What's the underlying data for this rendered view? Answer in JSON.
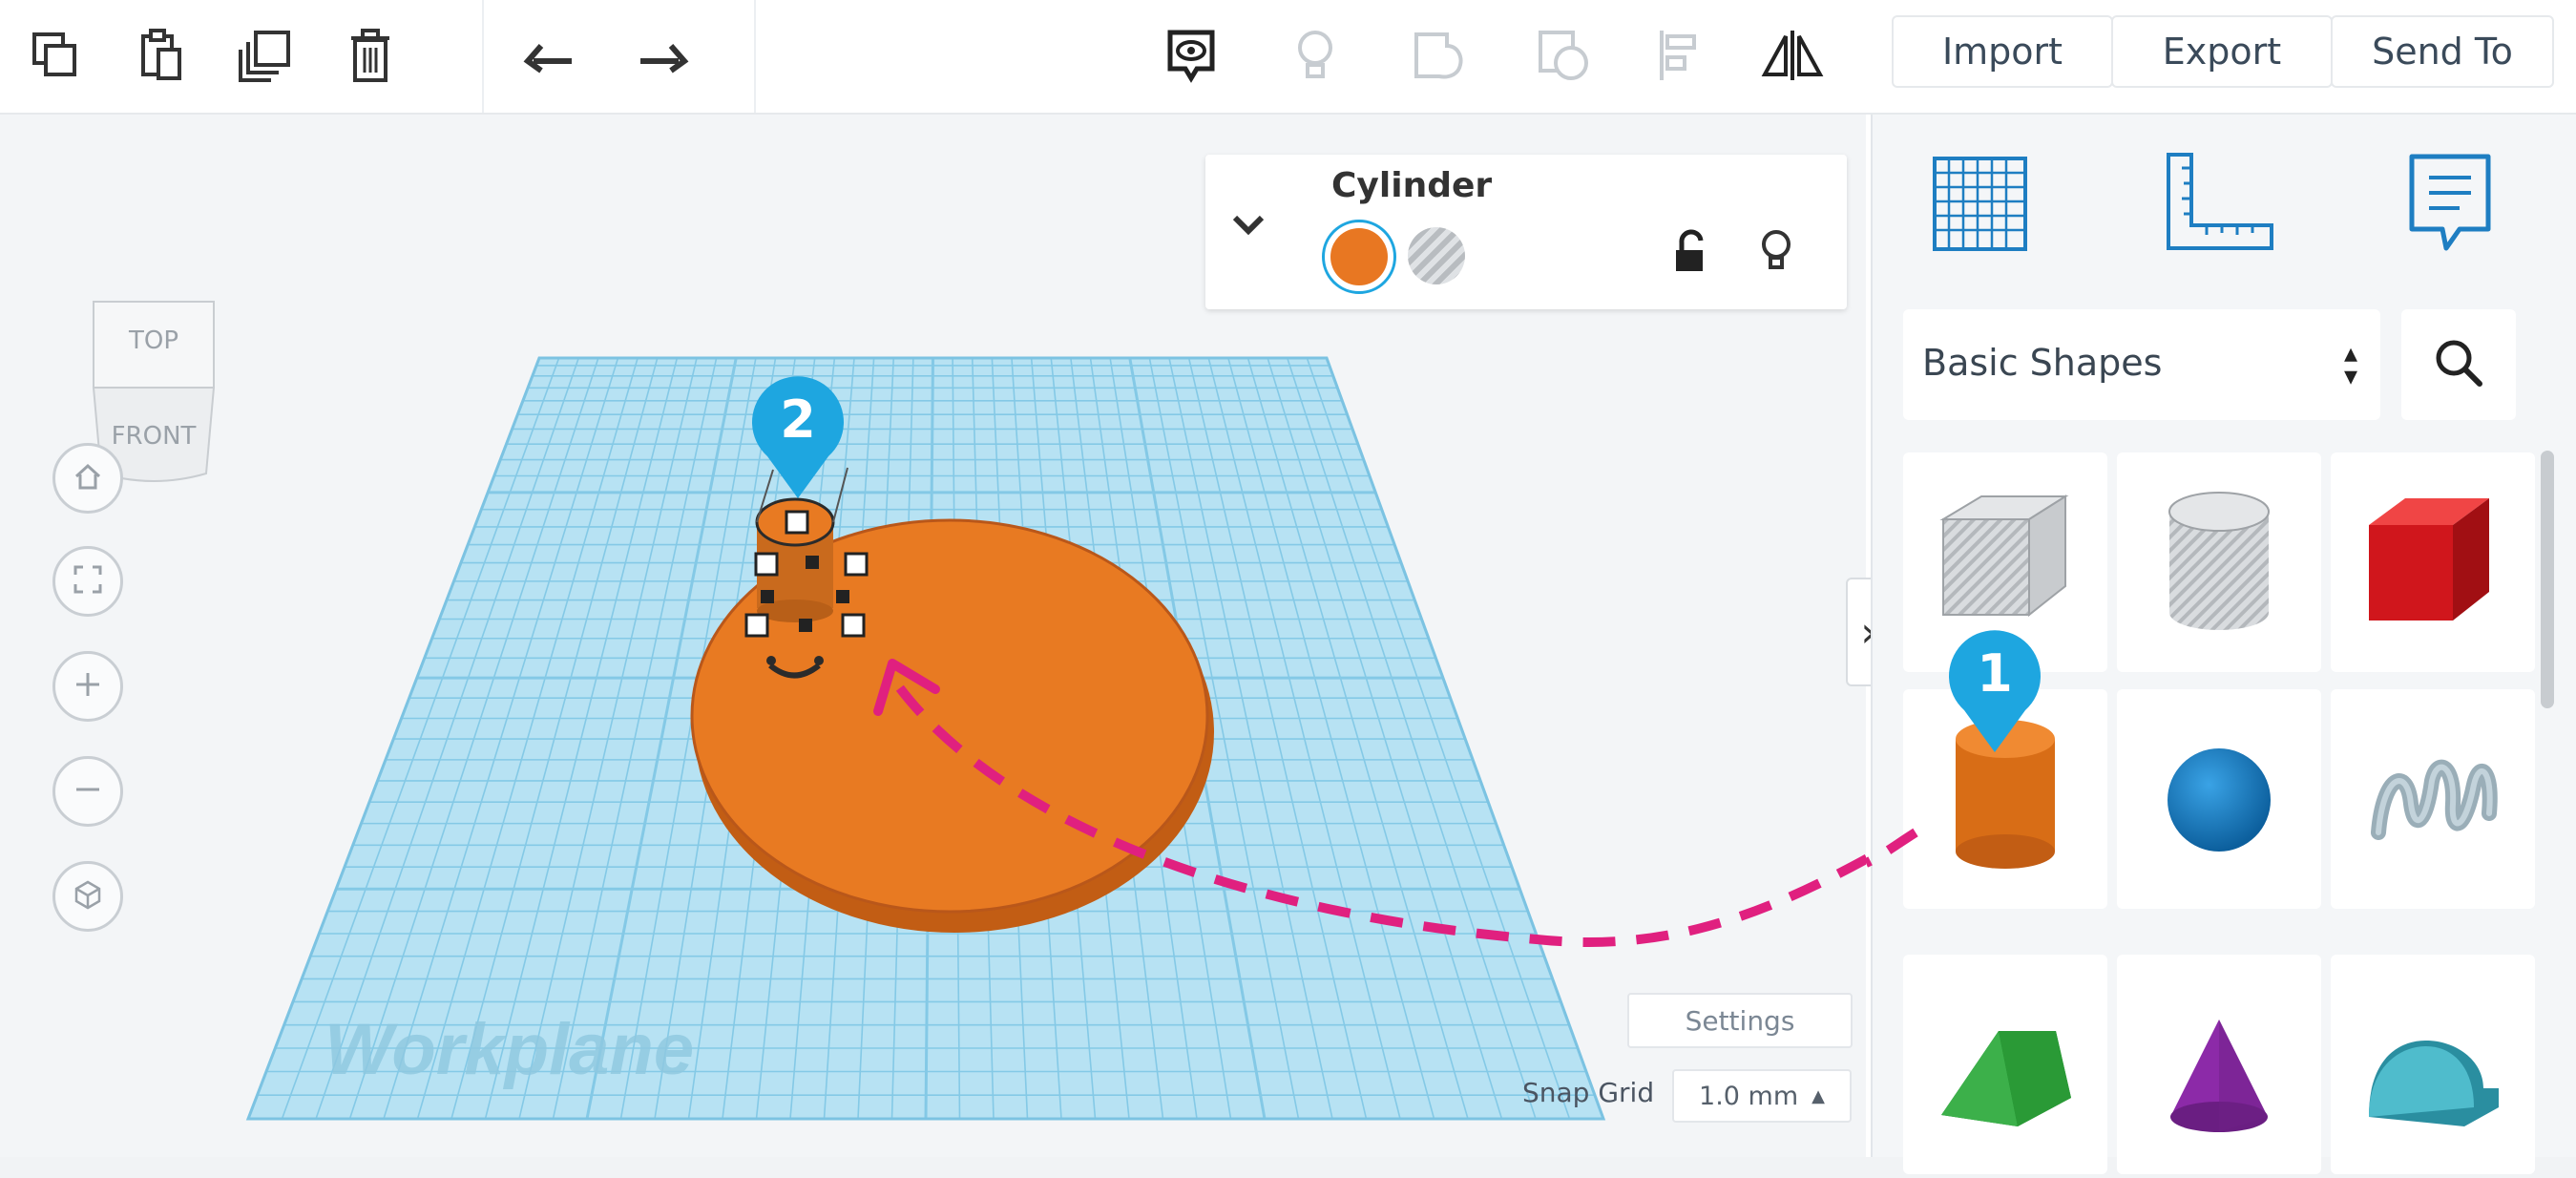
{
  "toolbar": {
    "tools": [
      {
        "name": "copy-icon"
      },
      {
        "name": "paste-icon"
      },
      {
        "name": "duplicate-icon"
      },
      {
        "name": "delete-icon"
      },
      {
        "name": "undo-icon"
      },
      {
        "name": "redo-icon"
      },
      {
        "name": "show-all-icon"
      },
      {
        "name": "lightbulb-icon"
      },
      {
        "name": "group-icon"
      },
      {
        "name": "ungroup-icon"
      },
      {
        "name": "align-icon"
      },
      {
        "name": "mirror-icon"
      }
    ],
    "import_label": "Import",
    "export_label": "Export",
    "send_to_label": "Send To"
  },
  "viewcube": {
    "top_label": "TOP",
    "front_label": "FRONT"
  },
  "inspector": {
    "title": "Cylinder",
    "solid_color": "#e87722",
    "hole_label": "hole"
  },
  "workplane": {
    "label": "Workplane",
    "grid_color": "#8fd3ec"
  },
  "canvas_footer": {
    "settings_label": "Settings",
    "snap_grid_label": "Snap Grid",
    "snap_grid_value": "1.0 mm"
  },
  "annotations": {
    "step_1": "1",
    "step_2": "2",
    "badge_color": "#1ea6e0",
    "arrow_color": "#e0207f"
  },
  "panel": {
    "category_label": "Basic Shapes",
    "shapes": [
      {
        "name": "box-hole"
      },
      {
        "name": "cylinder-hole"
      },
      {
        "name": "box"
      },
      {
        "name": "cylinder"
      },
      {
        "name": "sphere"
      },
      {
        "name": "scribble"
      },
      {
        "name": "roof"
      },
      {
        "name": "cone"
      },
      {
        "name": "round-roof"
      }
    ]
  }
}
